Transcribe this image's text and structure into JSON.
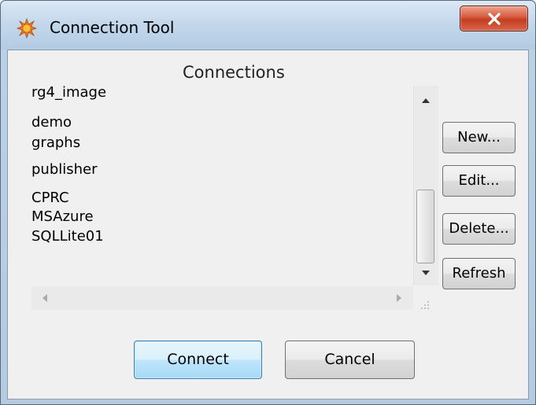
{
  "window": {
    "title": "Connection Tool",
    "icon": "starburst-app-icon",
    "accent_color": "#c23f21"
  },
  "connections": {
    "heading": "Connections",
    "items": [
      "rg4_image",
      "demo",
      "graphs",
      "publisher",
      "CPRC",
      "MSAzure",
      "SQLLite01"
    ]
  },
  "side_buttons": {
    "new_label": "New...",
    "edit_label": "Edit...",
    "delete_label": "Delete...",
    "refresh_label": "Refresh"
  },
  "footer": {
    "connect_label": "Connect",
    "cancel_label": "Cancel"
  }
}
